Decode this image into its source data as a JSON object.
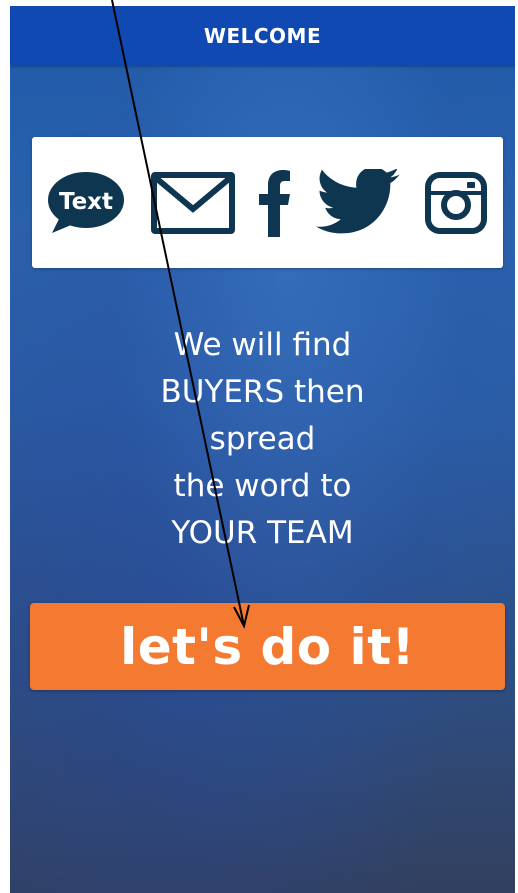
{
  "header": {
    "title": "WELCOME"
  },
  "share_options": {
    "text_icon_label": "Text",
    "icons": [
      "text-bubble-icon",
      "mail-envelope-icon",
      "facebook-icon",
      "twitter-bird-icon",
      "instagram-icon"
    ],
    "icon_color": "#0f3650"
  },
  "tagline": {
    "lines": [
      "We will find",
      "BUYERS then",
      "spread",
      "the word to",
      "YOUR TEAM"
    ]
  },
  "cta": {
    "label": "let's do it!",
    "color": "#f47a32"
  },
  "colors": {
    "header_bg": "#1149b3",
    "background_top": "#1f5aa8",
    "background_bottom": "#32405f"
  }
}
